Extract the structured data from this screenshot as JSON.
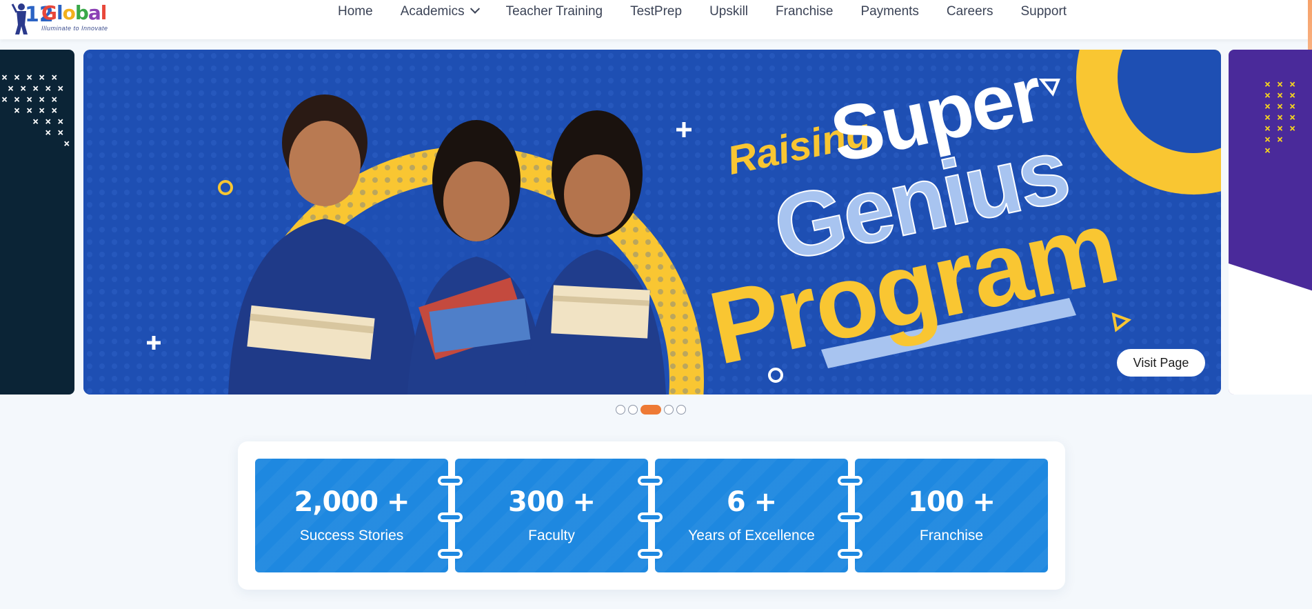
{
  "header": {
    "logo": {
      "number": "12",
      "brand": [
        "G",
        "l",
        "o",
        "b",
        "a",
        "l"
      ],
      "tagline": "Illuminate to Innovate"
    },
    "nav": [
      {
        "label": "Home"
      },
      {
        "label": "Academics",
        "has_dropdown": true
      },
      {
        "label": "Teacher Training"
      },
      {
        "label": "TestPrep"
      },
      {
        "label": "Upskill"
      },
      {
        "label": "Franchise"
      },
      {
        "label": "Payments"
      },
      {
        "label": "Careers"
      },
      {
        "label": "Support"
      }
    ]
  },
  "carousel": {
    "slide_heading": {
      "line1": "Raising",
      "line2": "Super",
      "line3": "Genius",
      "line4": "Program"
    },
    "visit_button": "Visit Page",
    "dots_count": 5,
    "active_dot": 2
  },
  "stats": [
    {
      "value": "2,000 +",
      "label": "Success Stories"
    },
    {
      "value": "300 +",
      "label": "Faculty"
    },
    {
      "value": "6 +",
      "label": "Years of Excellence"
    },
    {
      "value": "100 +",
      "label": "Franchise"
    }
  ],
  "colors": {
    "accent_orange": "#ee7a35",
    "hero_blue": "#1e4fb3",
    "hero_yellow": "#f9c632",
    "stat_blue": "#1e88e0"
  }
}
